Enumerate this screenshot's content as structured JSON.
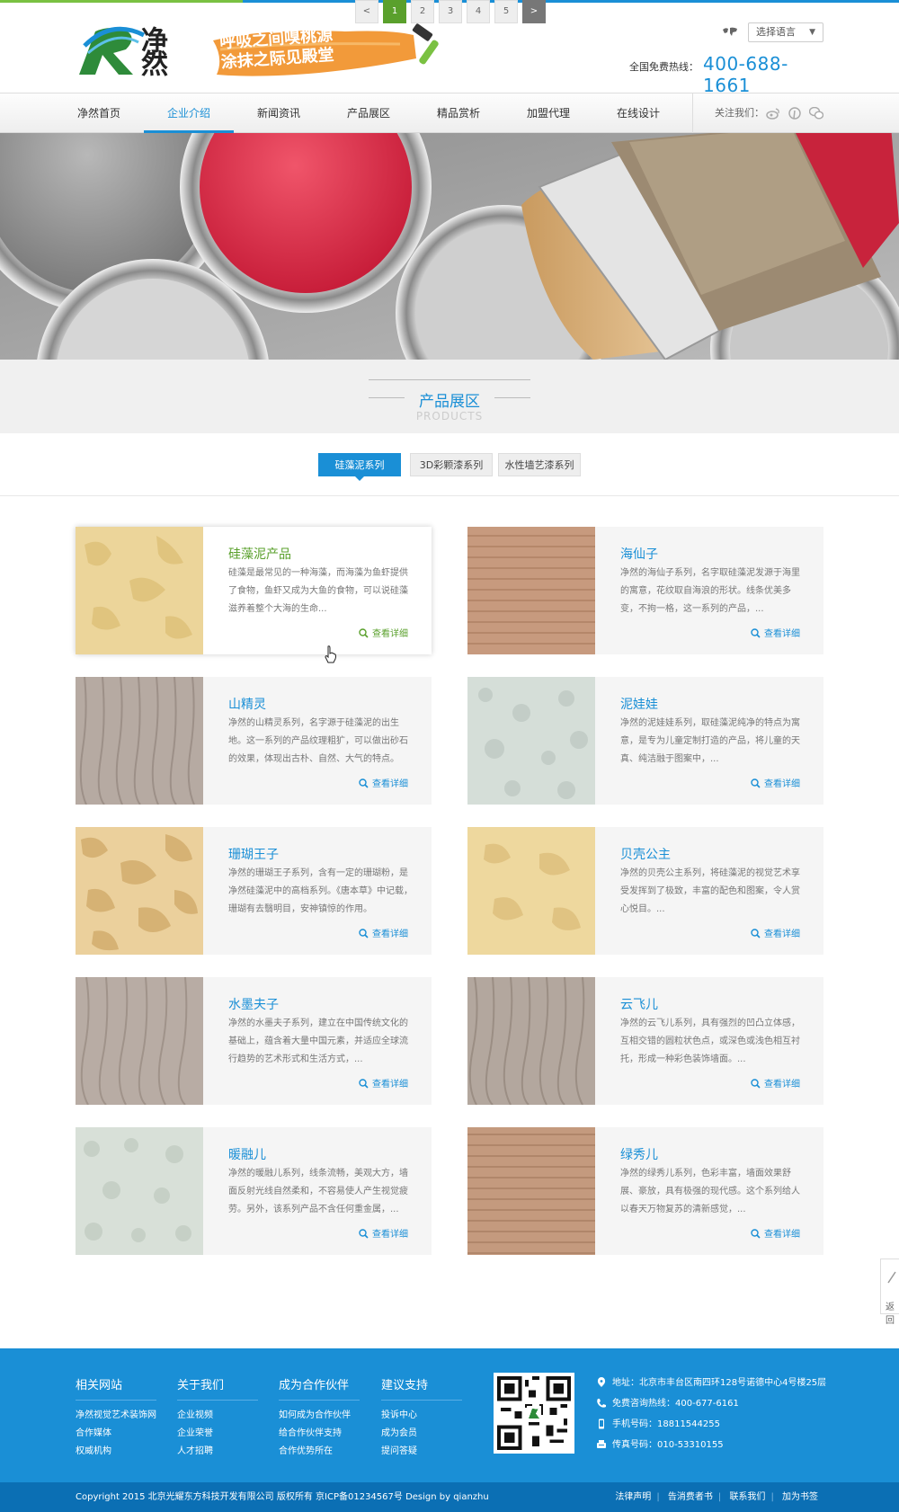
{
  "header": {
    "logo_text": "净然",
    "slogan_line1": "呼吸之间嗅桃源",
    "slogan_line2": "涂抹之际见殿堂",
    "language_select": "选择语言",
    "hotline_label": "全国免费热线：",
    "hotline_number": "400-688-1661"
  },
  "nav": {
    "items": [
      "净然首页",
      "企业介绍",
      "新闻资讯",
      "产品展区",
      "精品赏析",
      "加盟代理",
      "在线设计"
    ],
    "active_index": 1,
    "follow_label": "关注我们："
  },
  "section": {
    "title_cn": "产品展区",
    "title_en": "PRODUCTS"
  },
  "tabs": {
    "items": [
      "硅藻泥系列",
      "3D彩颗漆系列",
      "水性墙艺漆系列"
    ],
    "active_index": 0
  },
  "products": [
    {
      "name": "硅藻泥产品",
      "desc": "硅藻是最常见的一种海藻，而海藻为鱼虾提供了食物，鱼虾又成为大鱼的食物，可以说硅藻滋养着整个大海的生命...",
      "more": "查看详细"
    },
    {
      "name": "海仙子",
      "desc": "净然的海仙子系列，名字取硅藻泥发源于海里的寓意，花纹取自海浪的形状。线条优美多变，不拘一格，这一系列的产品，...",
      "more": "查看详细"
    },
    {
      "name": "山精灵",
      "desc": "净然的山精灵系列，名字源于硅藻泥的出生地。这一系列的产品纹理粗犷，可以做出砂石的效果，体现出古朴、自然、大气的特点。",
      "more": "查看详细"
    },
    {
      "name": "泥娃娃",
      "desc": "净然的泥娃娃系列，取硅藻泥纯净的特点为寓意，是专为儿童定制打造的产品，将儿童的天真、纯洁融于图案中，...",
      "more": "查看详细"
    },
    {
      "name": "珊瑚王子",
      "desc": "净然的珊瑚王子系列，含有一定的珊瑚粉，是净然硅藻泥中的高档系列。《唐本草》中记载，珊瑚有去翳明目，安神镇惊的作用。",
      "more": "查看详细"
    },
    {
      "name": "贝壳公主",
      "desc": "净然的贝壳公主系列，将硅藻泥的视觉艺术享受发挥到了极致，丰富的配色和图案，令人赏心悦目。...",
      "more": "查看详细"
    },
    {
      "name": "水墨夫子",
      "desc": "净然的水墨夫子系列，建立在中国传统文化的基础上，蕴含着大量中国元素，并适应全球流行趋势的艺术形式和生活方式，...",
      "more": "查看详细"
    },
    {
      "name": "云飞儿",
      "desc": "净然的云飞儿系列，具有强烈的凹凸立体感，互相交错的圆粒状色点，或深色或浅色相互衬托，形成一种彩色装饰墙面。...",
      "more": "查看详细"
    },
    {
      "name": "暖融儿",
      "desc": "净然的暖融儿系列，线条流畅，美观大方，墙面反射光线自然柔和，不容易使人产生视觉疲劳。另外，该系列产品不含任何重金属，...",
      "more": "查看详细"
    },
    {
      "name": "绿秀儿",
      "desc": "净然的绿秀儿系列，色彩丰富，墙面效果舒展、豪放，具有极强的现代感。这个系列给人以春天万物复苏的清新感觉，...",
      "more": "查看详细"
    }
  ],
  "pagination": {
    "prev": "<",
    "pages": [
      "1",
      "2",
      "3",
      "4",
      "5"
    ],
    "active_index": 0,
    "next": ">"
  },
  "side_float": {
    "label": "返回"
  },
  "footer": {
    "columns": [
      {
        "title": "相关网站",
        "items": [
          "净然视觉艺术装饰网",
          "合作媒体",
          "权威机构"
        ]
      },
      {
        "title": "关于我们",
        "items": [
          "企业视频",
          "企业荣誉",
          "人才招聘"
        ]
      },
      {
        "title": "成为合作伙伴",
        "items": [
          "如何成为合作伙伴",
          "给合作伙伴支持",
          "合作优势所在"
        ]
      },
      {
        "title": "建议支持",
        "items": [
          "投诉中心",
          "成为会员",
          "提问答疑"
        ]
      }
    ],
    "contact": {
      "address": "地址：北京市丰台区南四环128号诺德中心4号楼25层",
      "consult": "免费咨询热线：400-677-6161",
      "mobile": "手机号码：18811544255",
      "fax": "传真号码：010-53310155"
    },
    "copyright": "Copyright 2015 北京光耀东方科技开发有限公司 版权所有  京ICP备01234567号  Design by qianzhu",
    "links": [
      "法律声明",
      "告消费者书",
      "联系我们",
      "加为书签"
    ]
  },
  "colors": {
    "accent": "#1a8fd6",
    "green": "#5aa02c",
    "footer_dark": "#0b6fb4"
  }
}
